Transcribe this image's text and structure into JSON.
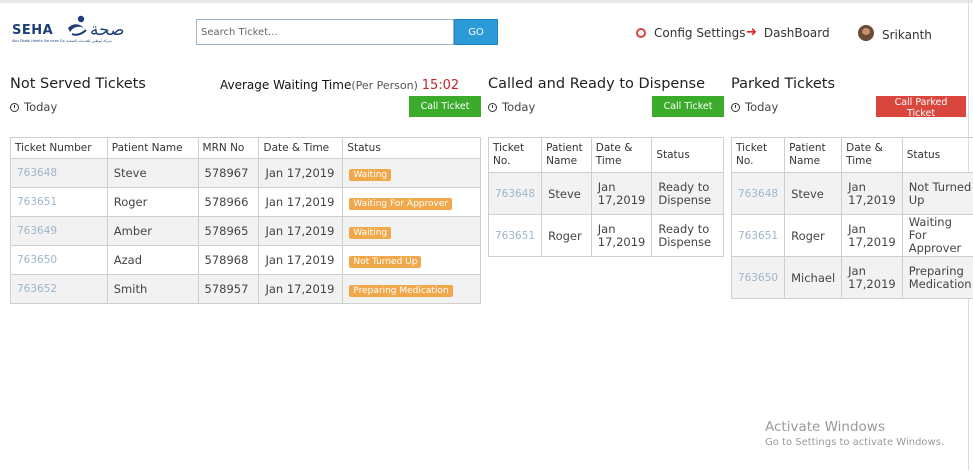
{
  "header": {
    "logo_text": "SEHA",
    "logo_arabic": "صحة",
    "logo_subtext": "Abu Dhabi Health Services Co. شركة أبوظبي للخدمات الصحية",
    "search_placeholder": "Search Ticket...",
    "go_label": "GO",
    "config_label": "Config Settings",
    "dashboard_label": "DashBoard",
    "user_name": "Srikanth"
  },
  "not_served": {
    "title": "Not Served Tickets",
    "today_label": "Today",
    "avg_label": "Average Waiting Time",
    "avg_per": "(Per Person)",
    "avg_value": "15:02",
    "button_label": "Call Ticket",
    "columns": [
      "Ticket Number",
      "Patient Name",
      "MRN No",
      "Date & Time",
      "Status"
    ],
    "rows": [
      {
        "ticket": "763648",
        "patient": "Steve",
        "mrn": "578967",
        "date": "Jan 17,2019",
        "status": "Waiting"
      },
      {
        "ticket": "763651",
        "patient": "Roger",
        "mrn": "578966",
        "date": "Jan 17,2019",
        "status": "Waiting For Approver"
      },
      {
        "ticket": "763649",
        "patient": "Amber",
        "mrn": "578965",
        "date": "Jan 17,2019",
        "status": "Waiting"
      },
      {
        "ticket": "763650",
        "patient": "Azad",
        "mrn": "578968",
        "date": "Jan 17,2019",
        "status": "Not Turned Up"
      },
      {
        "ticket": "763652",
        "patient": "Smith",
        "mrn": "578957",
        "date": "Jan 17,2019",
        "status": "Preparing Medication"
      }
    ]
  },
  "called": {
    "title": "Called and Ready to Dispense",
    "today_label": "Today",
    "button_label": "Call Ticket",
    "columns": {
      "ticket_1": "Ticket",
      "ticket_2": "No.",
      "patient_1": "Patient",
      "patient_2": "Name",
      "date_1": "Date &",
      "date_2": "Time",
      "status": "Status"
    },
    "rows": [
      {
        "ticket": "763648",
        "patient": "Steve",
        "date_1": "Jan",
        "date_2": "17,2019",
        "status_1": "Ready to",
        "status_2": "Dispense"
      },
      {
        "ticket": "763651",
        "patient": "Roger",
        "date_1": "Jan",
        "date_2": "17,2019",
        "status_1": "Ready to",
        "status_2": "Dispense"
      }
    ]
  },
  "parked": {
    "title": "Parked Tickets",
    "today_label": "Today",
    "button_label": "Call Parked Ticket",
    "columns": {
      "ticket_1": "Ticket",
      "ticket_2": "No.",
      "patient_1": "Patient",
      "patient_2": "Name",
      "date_1": "Date &",
      "date_2": "Time",
      "status": "Status"
    },
    "rows": [
      {
        "ticket": "763648",
        "patient": "Steve",
        "date_1": "Jan",
        "date_2": "17,2019",
        "status_1": "Not Turned",
        "status_2": "Up"
      },
      {
        "ticket": "763651",
        "patient": "Roger",
        "date_1": "Jan",
        "date_2": "17,2019",
        "status_1": "Waiting For",
        "status_2": "Approver"
      },
      {
        "ticket": "763650",
        "patient": "Michael",
        "date_1": "Jan",
        "date_2": "17,2019",
        "status_1": "Preparing",
        "status_2": "Medication"
      }
    ]
  },
  "watermark": {
    "line1": "Activate Windows",
    "line2": "Go to Settings to activate Windows."
  },
  "colors": {
    "green_button": "#3aab2b",
    "red_button": "#d9463e",
    "badge": "#f0a84a",
    "go_button": "#2d9ad8",
    "avg_value": "#c0262b"
  }
}
